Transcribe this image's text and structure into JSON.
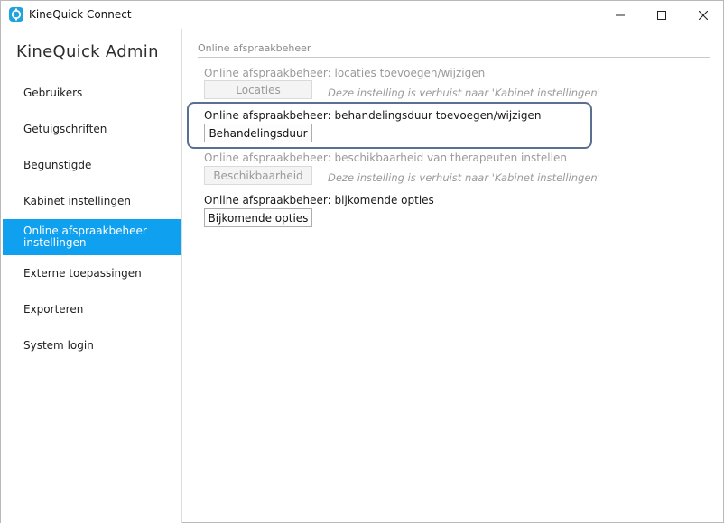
{
  "window": {
    "title": "KineQuick Connect",
    "icons": {
      "app": "app-logo-icon",
      "minimize": "minimize-icon",
      "maximize": "maximize-icon",
      "close": "close-icon"
    }
  },
  "sidebar": {
    "title": "KineQuick Admin",
    "items": [
      {
        "label": "Gebruikers"
      },
      {
        "label": "Getuigschriften"
      },
      {
        "label": "Begunstigde"
      },
      {
        "label": "Kabinet instellingen"
      },
      {
        "label": "Online afspraakbeheer\ninstellingen",
        "active": true
      },
      {
        "label": "Externe toepassingen"
      },
      {
        "label": "Exporteren"
      },
      {
        "label": "System login"
      }
    ],
    "active_color": "#0fa0ef"
  },
  "main": {
    "section_title": "Online afspraakbeheer",
    "rows": [
      {
        "label": "Online afspraakbeheer: locaties toevoegen/wijzigen",
        "button": "Locaties",
        "enabled": false,
        "note": "Deze instelling is verhuist naar 'Kabinet instellingen'"
      },
      {
        "label": "Online afspraakbeheer: behandelingsduur toevoegen/wijzigen",
        "button": "Behandelingsduur",
        "enabled": true,
        "highlighted": true
      },
      {
        "label": "Online afspraakbeheer: beschikbaarheid van therapeuten instellen",
        "button": "Beschikbaarheid",
        "enabled": false,
        "note": "Deze instelling is verhuist naar 'Kabinet instellingen'"
      },
      {
        "label": "Online afspraakbeheer: bijkomende opties",
        "button": "Bijkomende opties",
        "enabled": true
      }
    ],
    "highlight_color": "#5b6f8e"
  }
}
